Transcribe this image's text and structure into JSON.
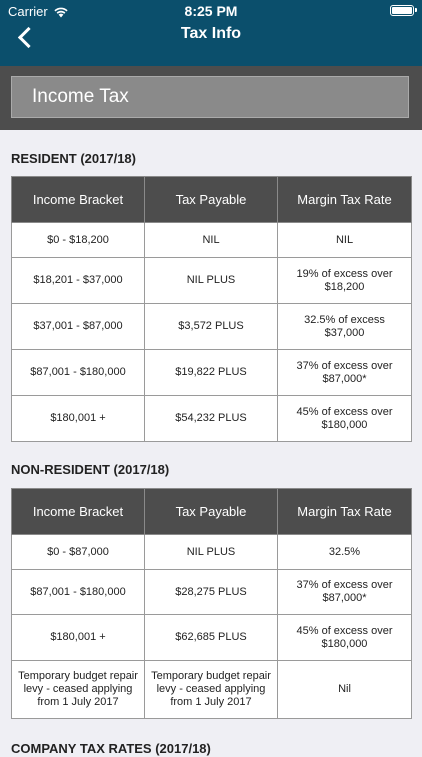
{
  "status_bar": {
    "carrier": "Carrier",
    "time": "8:25 PM"
  },
  "nav": {
    "title": "Tax Info"
  },
  "selector": {
    "value": "Income Tax"
  },
  "tables": [
    {
      "title": "RESIDENT (2017/18)",
      "headers": [
        "Income Bracket",
        "Tax Payable",
        "Margin Tax Rate"
      ],
      "rows": [
        [
          "$0 - $18,200",
          "NIL",
          "NIL"
        ],
        [
          "$18,201 - $37,000",
          "NIL PLUS",
          "19% of excess over $18,200"
        ],
        [
          "$37,001 - $87,000",
          "$3,572 PLUS",
          "32.5% of excess $37,000"
        ],
        [
          "$87,001 - $180,000",
          "$19,822 PLUS",
          "37% of excess over $87,000*"
        ],
        [
          "$180,001 +",
          "$54,232 PLUS",
          "45% of excess over $180,000"
        ]
      ]
    },
    {
      "title": "NON-RESIDENT (2017/18)",
      "headers": [
        "Income Bracket",
        "Tax Payable",
        "Margin Tax Rate"
      ],
      "rows": [
        [
          "$0 - $87,000",
          "NIL PLUS",
          "32.5%"
        ],
        [
          "$87,001 - $180,000",
          "$28,275 PLUS",
          "37% of excess over $87,000*"
        ],
        [
          "$180,001 +",
          "$62,685 PLUS",
          "45% of excess over $180,000"
        ],
        [
          "Temporary budget repair levy - ceased applying from 1 July 2017",
          "Temporary budget repair levy - ceased applying from 1 July 2017",
          "Nil"
        ]
      ]
    }
  ],
  "next_section": {
    "title": "COMPANY TAX RATES (2017/18)"
  },
  "colors": {
    "nav_bar": "#0b4f6c",
    "header_band": "#4d4d4d",
    "selector_fill": "#8a8a8a",
    "page_bg": "#efeff4"
  },
  "icons": {
    "back": "chevron-left-icon",
    "wifi": "wifi-icon",
    "battery": "battery-icon"
  }
}
